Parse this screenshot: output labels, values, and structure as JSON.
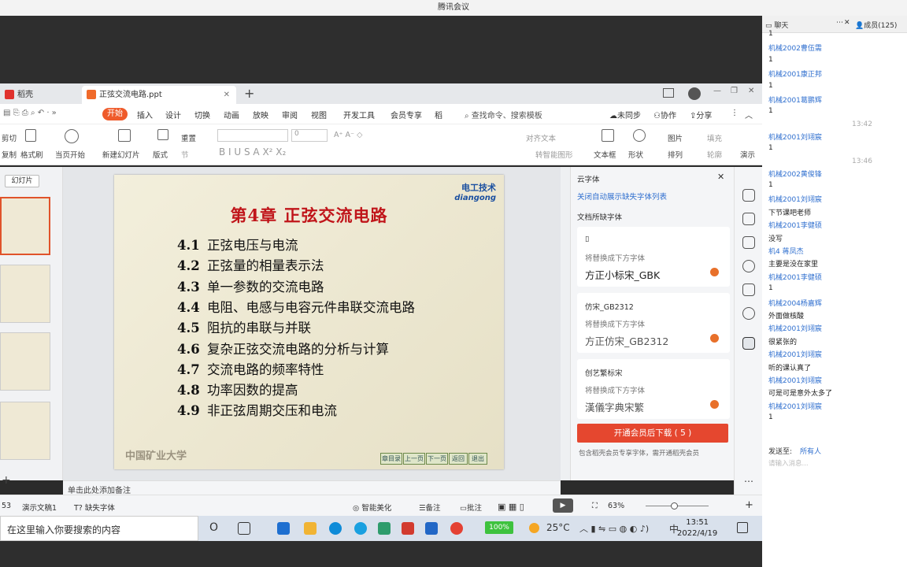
{
  "window_title": "腾讯会议",
  "wps": {
    "tabs": [
      "稻壳",
      "正弦交流电路.ppt"
    ],
    "menu": [
      "开始",
      "插入",
      "设计",
      "切换",
      "动画",
      "放映",
      "审阅",
      "视图",
      "开发工具",
      "会员专享",
      "稻"
    ],
    "search_placeholder": "查找命令、搜索模板",
    "right_actions": [
      "未同步",
      "协作",
      "分享"
    ],
    "ribbon": {
      "cut": "剪切",
      "copy": "复制",
      "format_painter": "格式刷",
      "play_from_current": "当页开始",
      "new_slide": "新建幻灯片",
      "layout": "版式",
      "section": "节",
      "reset": "重置",
      "font_size": "0",
      "align_text": "对齐文本",
      "smart_graphic": "转智能图形",
      "textbox": "文本框",
      "shape": "形状",
      "picture": "图片",
      "arrange": "排列",
      "fill": "填充",
      "outline": "轮廓",
      "present": "演示"
    },
    "slides_label": "幻灯片",
    "notes_placeholder": "单击此处添加备注",
    "status": {
      "slide_count": "53",
      "theme": "演示文稿1",
      "missing_font": "缺失字体",
      "beautify": "智能美化",
      "notes": "备注",
      "comments": "批注",
      "zoom": "63%"
    }
  },
  "slide": {
    "title": "第4章  正弦交流电路",
    "logo_cn": "电工技术",
    "logo_en": "diangong",
    "items": [
      {
        "num": "4.1",
        "text": "正弦电压与电流"
      },
      {
        "num": "4.2",
        "text": "正弦量的相量表示法"
      },
      {
        "num": "4.3",
        "text": "单一参数的交流电路"
      },
      {
        "num": "4.4",
        "text": "电阻、电感与电容元件串联交流电路"
      },
      {
        "num": "4.5",
        "text": "阻抗的串联与并联"
      },
      {
        "num": "4.6",
        "text": "复杂正弦交流电路的分析与计算"
      },
      {
        "num": "4.7",
        "text": "交流电路的频率特性"
      },
      {
        "num": "4.8",
        "text": "功率因数的提高"
      },
      {
        "num": "4.9",
        "text": "非正弦周期交压和电流"
      }
    ],
    "university": "中国矿业大学",
    "nav": [
      "章目录",
      "上一页",
      "下一页",
      "返回",
      "退出"
    ]
  },
  "font_panel": {
    "title": "云字体",
    "link": "关闭自动展示缺失字体列表",
    "section": "文档所缺字体",
    "cards": [
      {
        "missing": "▯",
        "replace_label": "将替换成下方字体",
        "font": "方正小标宋_GBK"
      },
      {
        "missing": "仿宋_GB2312",
        "replace_label": "将替换成下方字体",
        "font": "方正仿宋_GB2312"
      },
      {
        "missing": "创艺繁标宋",
        "replace_label": "将替换成下方字体",
        "font": "漢儀字典宋繁"
      }
    ],
    "download_btn": "开通会员后下载 ( 5 )",
    "footer": "包含稻壳会员专享字体，需开通稻壳会员"
  },
  "taskbar": {
    "search": "在这里输入你要搜索的内容",
    "battery": "100%",
    "temp": "25°C",
    "ime": "中",
    "time": "13:51",
    "date": "2022/4/19"
  },
  "chat": {
    "tab_chat": "聊天",
    "tab_members": "成员(125)",
    "messages": [
      {
        "k": "m",
        "t": "1"
      },
      {
        "k": "u",
        "t": "机械2002曹伍需"
      },
      {
        "k": "m",
        "t": "1"
      },
      {
        "k": "u",
        "t": "机械2001康正邦"
      },
      {
        "k": "m",
        "t": "1"
      },
      {
        "k": "u",
        "t": "机械2001葛鹏辉"
      },
      {
        "k": "m",
        "t": "1"
      },
      {
        "k": "t",
        "t": "13:42"
      },
      {
        "k": "u",
        "t": "机械2001刘翊宸"
      },
      {
        "k": "m",
        "t": "1"
      },
      {
        "k": "t",
        "t": "13:46"
      },
      {
        "k": "u",
        "t": "机械2002黄俊锋"
      },
      {
        "k": "m",
        "t": "1"
      },
      {
        "k": "u",
        "t": "机械2001刘翊宸"
      },
      {
        "k": "m",
        "t": "下节课吧老师"
      },
      {
        "k": "u",
        "t": "机械2001李健硕"
      },
      {
        "k": "m",
        "t": "没写"
      },
      {
        "k": "u",
        "t": "机4 蒋凤杰"
      },
      {
        "k": "m",
        "t": "主要是没在家里"
      },
      {
        "k": "u",
        "t": "机械2001李健硕"
      },
      {
        "k": "m",
        "t": "1"
      },
      {
        "k": "u",
        "t": "机械2004杨嘉辉"
      },
      {
        "k": "m",
        "t": "外面做核酸"
      },
      {
        "k": "u",
        "t": "机械2001刘翊宸"
      },
      {
        "k": "m",
        "t": "很紧张的"
      },
      {
        "k": "u",
        "t": "机械2001刘翊宸"
      },
      {
        "k": "m",
        "t": "听的课认真了"
      },
      {
        "k": "u",
        "t": "机械2001刘翊宸"
      },
      {
        "k": "m",
        "t": "可是可是意外太多了"
      },
      {
        "k": "u",
        "t": "机械2001刘翊宸"
      },
      {
        "k": "m",
        "t": "1"
      }
    ],
    "send_to_label": "发送至:",
    "send_to_value": "所有人",
    "input_placeholder": "请输入消息..."
  }
}
